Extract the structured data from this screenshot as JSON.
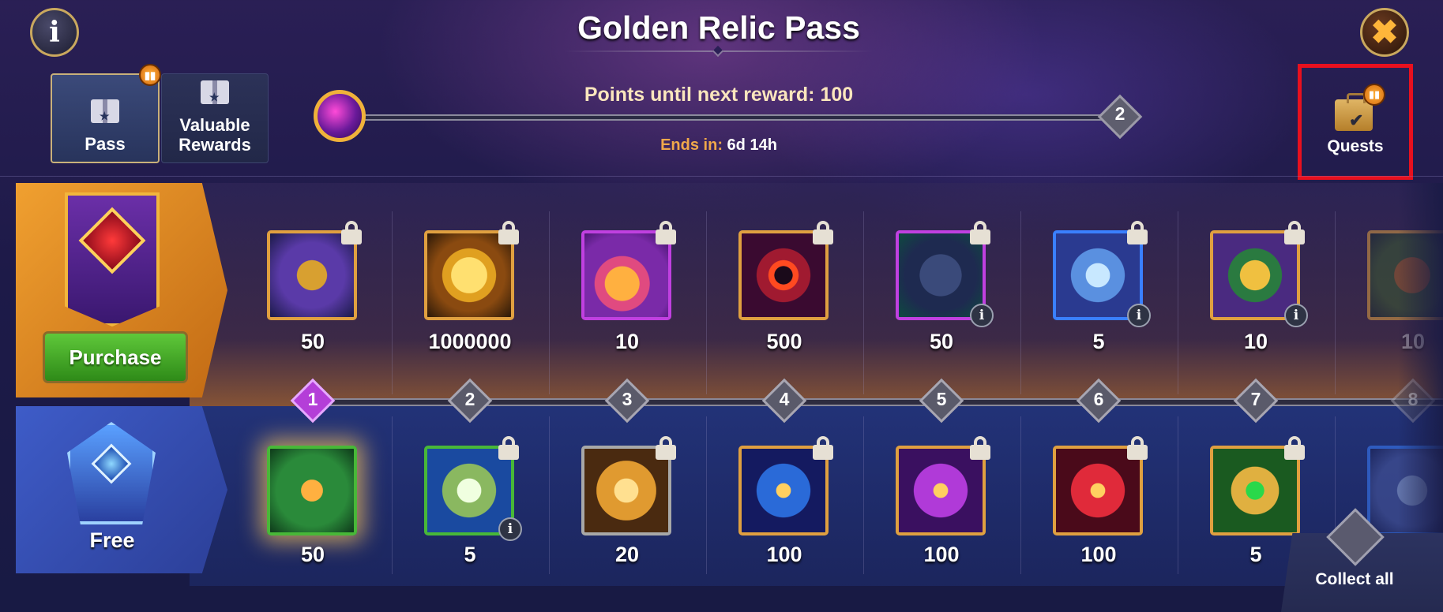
{
  "window": {
    "title": "Golden Relic Pass"
  },
  "tabs": [
    {
      "label": "Pass",
      "icon": "gift-icon",
      "active": true
    },
    {
      "label": "Valuable Rewards",
      "icon": "winged-gift-icon",
      "active": false
    }
  ],
  "progress": {
    "points_text": "Points until next reward: 100",
    "ends_label": "Ends in:",
    "ends_value": "6d 14h",
    "next_level": "2"
  },
  "quests": {
    "label": "Quests",
    "icon": "briefcase-check-icon",
    "highlighted": true
  },
  "paid_track": {
    "purchase_label": "Purchase",
    "rewards": [
      {
        "icon": "fox-hero-token-icon",
        "qty": "50",
        "locked": true,
        "info": false
      },
      {
        "icon": "gold-coin-icon",
        "qty": "1000000",
        "locked": true,
        "info": false
      },
      {
        "icon": "potion-flask-icon",
        "qty": "10",
        "locked": true,
        "info": false
      },
      {
        "icon": "red-emblem-icon",
        "qty": "500",
        "locked": true,
        "info": false
      },
      {
        "icon": "dark-chest-icon",
        "qty": "50",
        "locked": true,
        "info": true
      },
      {
        "icon": "blue-lantern-box-icon",
        "qty": "5",
        "locked": true,
        "info": true
      },
      {
        "icon": "golden-treasure-chest-icon",
        "qty": "10",
        "locked": true,
        "info": true
      },
      {
        "icon": "chest-icon",
        "qty": "10",
        "locked": true,
        "info": false
      }
    ]
  },
  "levels": [
    "1",
    "2",
    "3",
    "4",
    "5",
    "6",
    "7",
    "8"
  ],
  "free_track": {
    "label": "Free",
    "rewards": [
      {
        "icon": "elixir-vial-icon",
        "qty": "50",
        "locked": false,
        "info": false
      },
      {
        "icon": "green-lantern-box-icon",
        "qty": "5",
        "locked": true,
        "info": true
      },
      {
        "icon": "sword-badge-icon",
        "qty": "20",
        "locked": true,
        "info": false
      },
      {
        "icon": "blue-eye-orb-icon",
        "qty": "100",
        "locked": true,
        "info": false
      },
      {
        "icon": "purple-eye-orb-icon",
        "qty": "100",
        "locked": true,
        "info": false
      },
      {
        "icon": "red-eye-orb-icon",
        "qty": "100",
        "locked": true,
        "info": false
      },
      {
        "icon": "green-sun-key-icon",
        "qty": "5",
        "locked": true,
        "info": false
      },
      {
        "icon": "box-icon",
        "qty": "",
        "locked": true,
        "info": false
      }
    ]
  },
  "collect_all": {
    "label": "Collect all",
    "icon": "collect-chest-icon"
  }
}
